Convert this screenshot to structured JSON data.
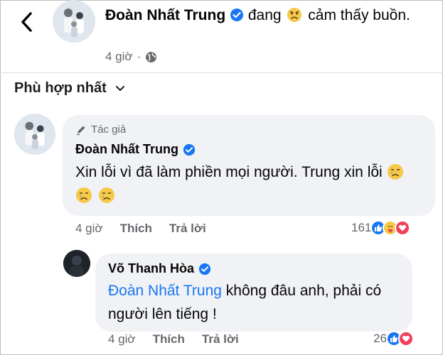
{
  "header": {
    "back_icon": "chevron-left-icon",
    "poster_name": "Đoàn Nhất Trung",
    "feeling_prefix": "đang",
    "feeling_emoji": "sad-face-emoji",
    "feeling_suffix": "cảm thấy buồn.",
    "time": "4 giờ",
    "separator": "·",
    "privacy_icon": "globe-icon"
  },
  "sort": {
    "label": "Phù hợp nhất",
    "icon": "chevron-down-icon"
  },
  "comments": [
    {
      "author_tag": "Tác giả",
      "author_tag_icon": "pen-icon",
      "name": "Đoàn Nhất Trung",
      "verified": true,
      "text": "Xin lỗi vì đã làm phiền mọi người. Trung xin lỗi",
      "emojis": [
        "crying-face-emoji",
        "crying-face-emoji",
        "crying-face-emoji"
      ],
      "time": "4 giờ",
      "like_label": "Thích",
      "reply_label": "Trả lời",
      "reaction_count": "161",
      "reactions": [
        "like-reaction-icon",
        "care-reaction-icon",
        "love-reaction-icon"
      ]
    },
    {
      "name": "Võ Thanh Hòa",
      "verified": true,
      "mention": "Đoàn Nhất Trung",
      "text": "không đâu anh, phải có người lên tiếng !",
      "time": "4 giờ",
      "like_label": "Thích",
      "reply_label": "Trả lời",
      "reaction_count": "26",
      "reactions": [
        "like-reaction-icon",
        "love-reaction-icon"
      ]
    }
  ],
  "colors": {
    "link_blue": "#1877f2",
    "bubble_bg": "#f0f2f5",
    "meta_gray": "#65676b"
  }
}
